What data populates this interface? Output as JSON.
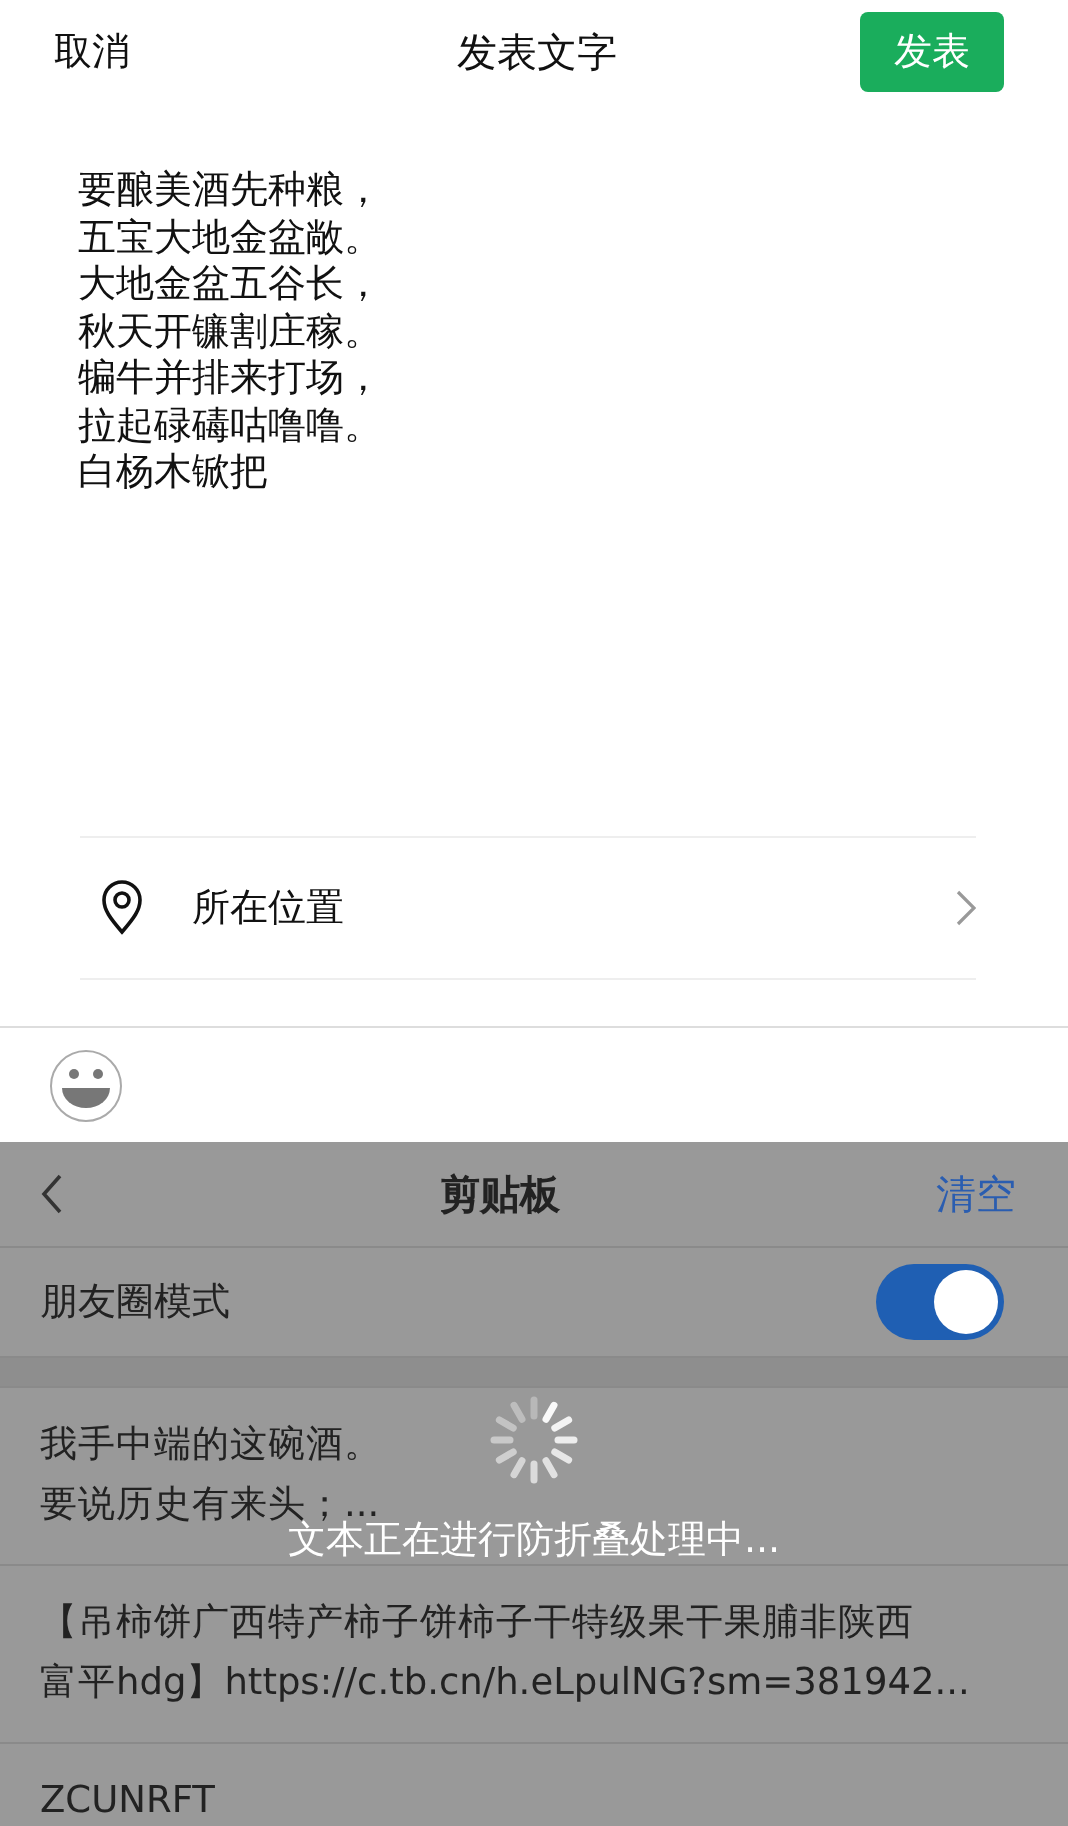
{
  "header": {
    "cancel": "取消",
    "title": "发表文字",
    "publish": "发表"
  },
  "post_text": {
    "lines": [
      "要酿美酒先种粮，",
      "五宝大地金盆敞。",
      "大地金盆五谷长，",
      "秋天开镰割庄稼。",
      "犏牛并排来打场，",
      "拉起碌碡咕噜噜。",
      "白杨木锨把"
    ]
  },
  "location": {
    "label": "所在位置"
  },
  "clipboard": {
    "title": "剪贴板",
    "clear": "清空",
    "mode": {
      "label": "朋友圈模式",
      "on": true
    },
    "items": [
      {
        "lines": [
          "我手中端的这碗酒。",
          "要说历史有来头；..."
        ]
      },
      {
        "lines": [
          "【吊柿饼广西特产柿子饼柿子干特级果干果脯非陕西",
          "富平hdg】https://c.tb.cn/h.eLpulNG?sm=381942..."
        ]
      },
      {
        "lines": [
          "ZCUNRFT"
        ]
      }
    ]
  },
  "toast": {
    "text": "文本正在进行防折叠处理中..."
  }
}
